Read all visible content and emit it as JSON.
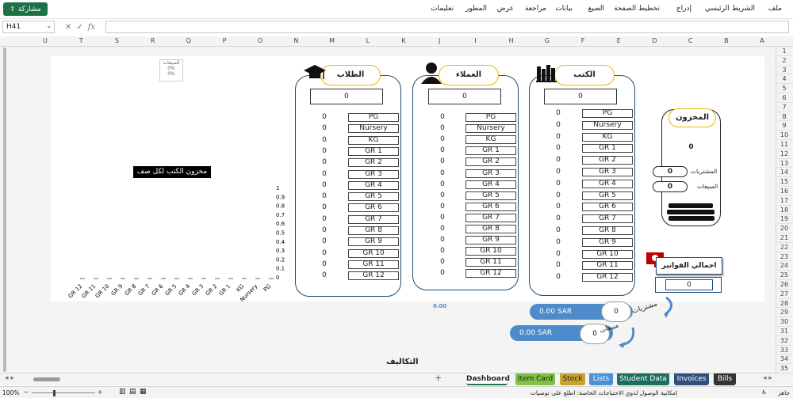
{
  "menu": {
    "items": [
      "ملف",
      "الشريط الرئيسي",
      "إدراج",
      "تخطيط الصفحة",
      "الصيغ",
      "بيانات",
      "مراجعة",
      "عرض",
      "المطور",
      "تعليمات"
    ],
    "share_label": "مشاركة"
  },
  "formula_bar": {
    "name_box": "H41",
    "fx": "fx",
    "value": ""
  },
  "columns": [
    "A",
    "B",
    "C",
    "D",
    "E",
    "F",
    "G",
    "H",
    "I",
    "J",
    "K",
    "L",
    "M",
    "N",
    "O",
    "P",
    "Q",
    "R",
    "S",
    "T",
    "U"
  ],
  "rows": [
    "1",
    "2",
    "3",
    "4",
    "5",
    "6",
    "7",
    "8",
    "9",
    "10",
    "11",
    "12",
    "13",
    "14",
    "15",
    "16",
    "17",
    "18",
    "19",
    "20",
    "21",
    "22",
    "23",
    "24",
    "25",
    "26",
    "27",
    "28",
    "29",
    "30",
    "31",
    "32",
    "33",
    "34",
    "35"
  ],
  "grades": [
    "PG",
    "Nursery",
    "KG",
    "GR 1",
    "GR 2",
    "GR 3",
    "GR 4",
    "GR 5",
    "GR 6",
    "GR 7",
    "GR 8",
    "GR 9",
    "GR 10",
    "GR 11",
    "GR 12"
  ],
  "books": {
    "title": "الكتب",
    "total": "0",
    "values": [
      "0",
      "0",
      "0",
      "0",
      "0",
      "0",
      "0",
      "0",
      "0",
      "0",
      "0",
      "0",
      "0",
      "0",
      "0"
    ]
  },
  "customers": {
    "title": "العملاء",
    "total": "0",
    "values": [
      "0",
      "0",
      "0",
      "0",
      "0",
      "0",
      "0",
      "0",
      "0",
      "0",
      "0",
      "0",
      "0",
      "0",
      "0"
    ]
  },
  "students": {
    "title": "الطلاب",
    "total": "0",
    "values": [
      "0",
      "0",
      "0",
      "0",
      "0",
      "0",
      "0",
      "0",
      "0",
      "0",
      "0",
      "0",
      "0",
      "0",
      "0"
    ]
  },
  "stock": {
    "title": "المخزون",
    "total": "0",
    "purchases_label": "المشتريات",
    "purchases": "0",
    "sales_label": "المبيعات",
    "sales": "0"
  },
  "invoices": {
    "title": "اجمالي الفواتير",
    "value": "0"
  },
  "purchases_blob": {
    "label": "مشتريات",
    "amount": "0.00 SAR",
    "count": "0"
  },
  "sales_blob": {
    "label": "مبيعات",
    "amount": "0.00 SAR",
    "count": "0"
  },
  "center_value": "0.00",
  "costs_label": "التكاليف",
  "mini_legend": {
    "header": "المبيعات",
    "v1": "0%",
    "v2": "0%"
  },
  "chart_data": {
    "type": "line",
    "title": "مخزون الكتب لكل صف",
    "categories": [
      "PG",
      "Nursery",
      "KG",
      "GR 1",
      "GR 2",
      "GR 3",
      "GR 4",
      "GR 5",
      "GR 6",
      "GR 7",
      "GR 8",
      "GR 9",
      "GR 10",
      "GR 11",
      "GR 12"
    ],
    "values": [
      0,
      0,
      0,
      0,
      0,
      0,
      0,
      0,
      0,
      0,
      0,
      0,
      0,
      0,
      0
    ],
    "yticks": [
      "0",
      "0.1",
      "0.2",
      "0.3",
      "0.4",
      "0.5",
      "0.6",
      "0.7",
      "0.8",
      "0.9",
      "1"
    ],
    "ylim": [
      0,
      1
    ]
  },
  "tabs": [
    {
      "label": "Dashboard",
      "color": "#ffffff",
      "text": "#222222"
    },
    {
      "label": "Item Card",
      "color": "#7fc241",
      "text": "#222222"
    },
    {
      "label": "Stock",
      "color": "#c8a232",
      "text": "#222222"
    },
    {
      "label": "Lists",
      "color": "#4a90d9",
      "text": "#ffffff"
    },
    {
      "label": "Student Data",
      "color": "#1c6e5f",
      "text": "#ffffff"
    },
    {
      "label": "Invoices",
      "color": "#2f4f7f",
      "text": "#ffffff"
    },
    {
      "label": "Bills",
      "color": "#333333",
      "text": "#ffffff"
    }
  ],
  "status": {
    "ready": "جاهز",
    "accessibility": "إمكانية الوصول لذوي الاحتياجات الخاصة: اطلع على توصيات",
    "zoom": "100%"
  }
}
